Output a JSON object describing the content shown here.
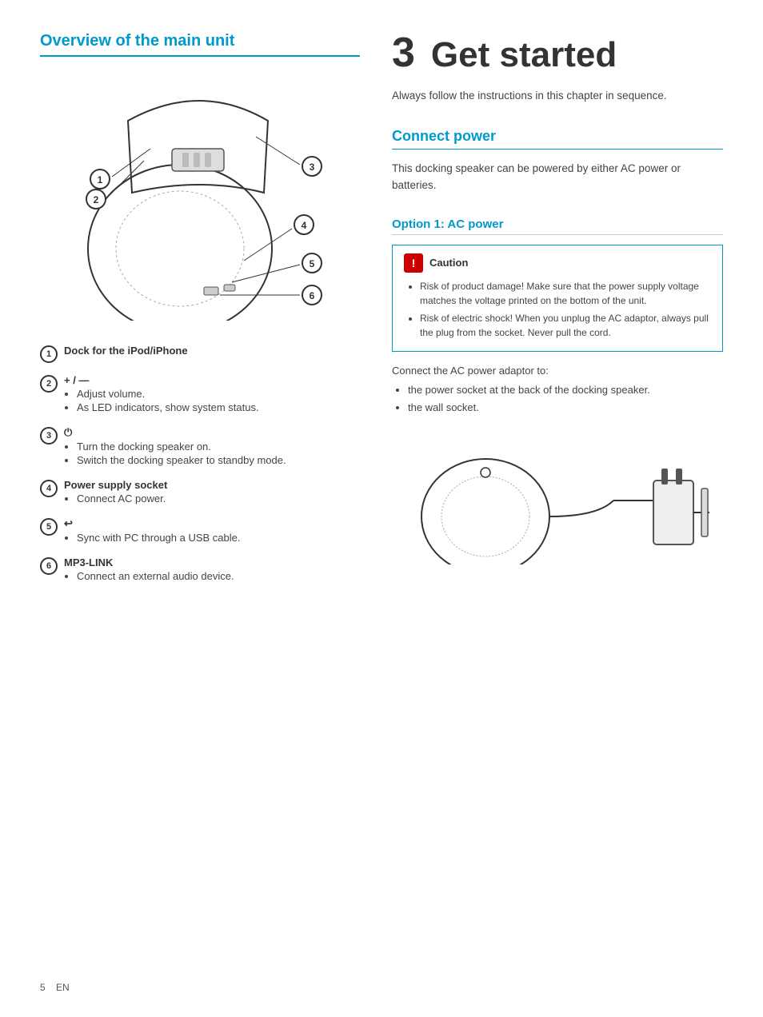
{
  "left": {
    "section_title": "Overview of the main unit",
    "labels": [
      {
        "number": "1",
        "title": "Dock for the iPod/iPhone",
        "bullets": []
      },
      {
        "number": "2",
        "title": "+ / —",
        "bullets": [
          "Adjust volume.",
          "As LED indicators, show system status."
        ]
      },
      {
        "number": "3",
        "title": "⏻",
        "bullets": [
          "Turn the docking speaker on.",
          "Switch the docking speaker to standby mode."
        ]
      },
      {
        "number": "4",
        "title": "Power supply socket",
        "bullets": [
          "Connect AC power."
        ]
      },
      {
        "number": "5",
        "title": "⇦",
        "bullets": [
          "Sync with PC through a USB cable."
        ]
      },
      {
        "number": "6",
        "title": "MP3-LINK",
        "bullets": [
          "Connect an external audio device."
        ]
      }
    ]
  },
  "right": {
    "chapter_number": "3",
    "chapter_title": "Get started",
    "chapter_intro": "Always follow the instructions in this chapter in sequence.",
    "connect_power_title": "Connect power",
    "connect_power_desc": "This docking speaker can be powered by either AC power or batteries.",
    "option1_title": "Option 1: AC power",
    "caution_label": "Caution",
    "caution_bullets": [
      "Risk of product damage! Make sure that the power supply voltage matches the voltage printed on the bottom of the unit.",
      "Risk of electric shock! When you unplug the AC adaptor, always pull the plug from the socket. Never pull the cord."
    ],
    "connect_ac_label": "Connect the AC power adaptor to:",
    "connect_ac_bullets": [
      "the power socket at the back of the docking speaker.",
      "the wall socket."
    ]
  },
  "footer": {
    "page_number": "5",
    "language": "EN"
  }
}
